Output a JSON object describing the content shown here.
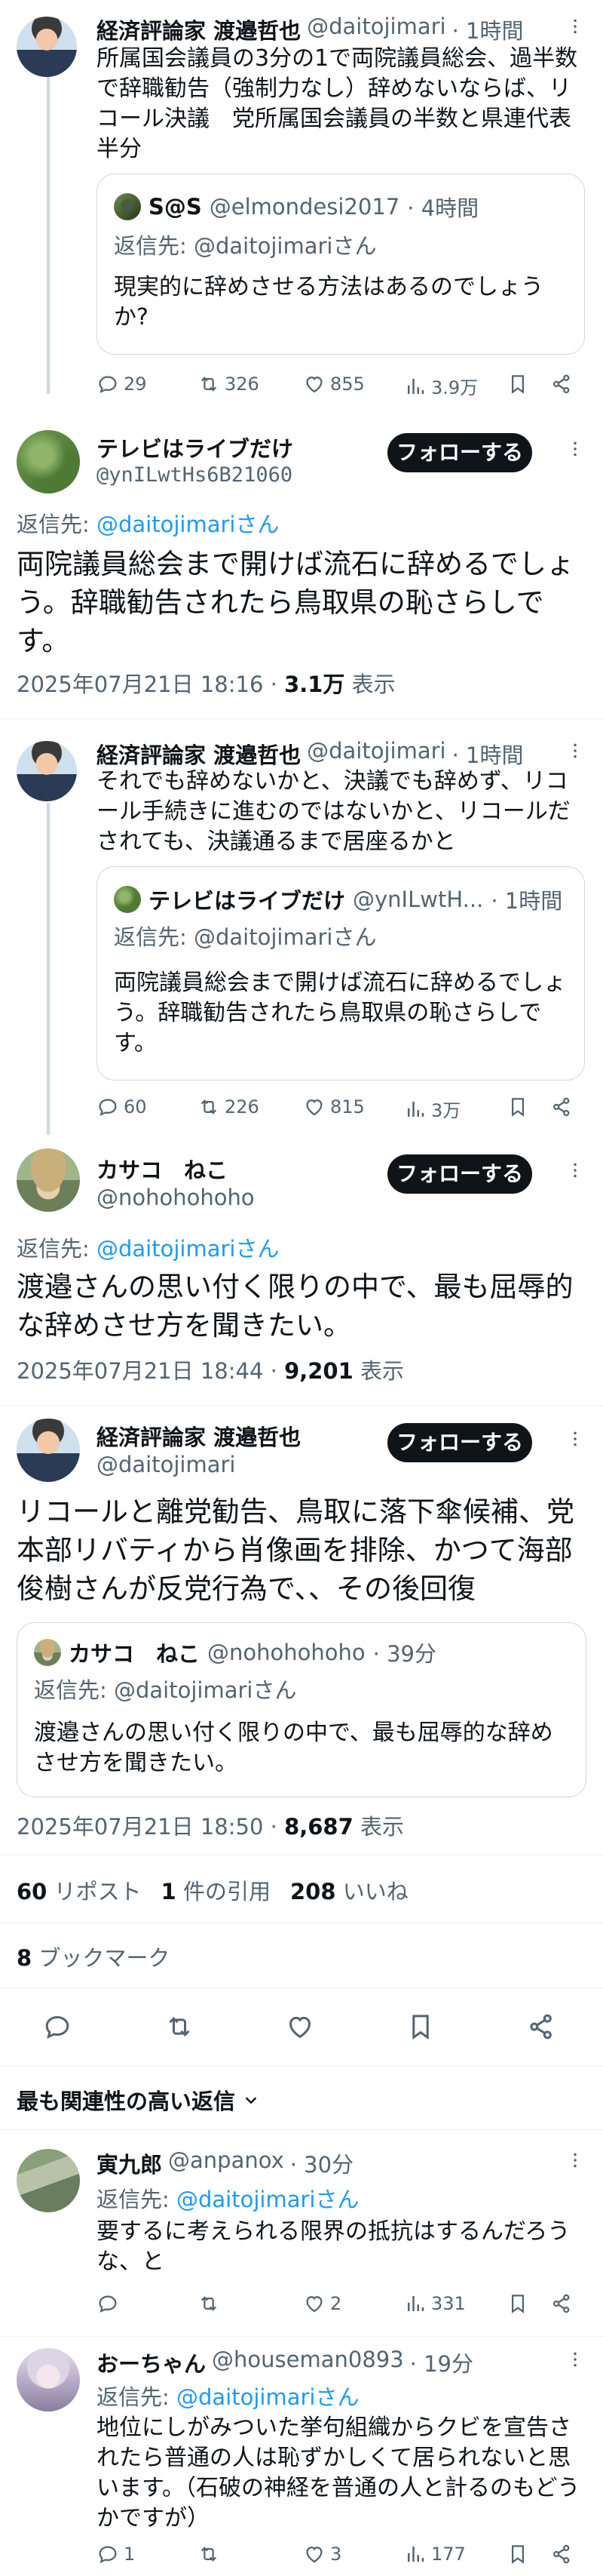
{
  "tweet1": {
    "name": "経済評論家 渡邉哲也",
    "handle": "@daitojimari",
    "time": "· 1時間",
    "text": "所属国会議員の3分の1で両院議員総会、過半数で辞職勧告（強制力なし）辞めないならば、リコール決議　党所属国会議員の半数と県連代表半分",
    "quote": {
      "name": "S@S",
      "handle": "@elmondesi2017",
      "time": "· 4時間",
      "reply_to": "返信先: @daitojimariさん",
      "text": "現実的に辞めさせる方法はあるのでしょうか?"
    },
    "actions": {
      "replies": "29",
      "reposts": "326",
      "likes": "855",
      "views": "3.9万"
    }
  },
  "tweet2": {
    "name": "テレビはライブだけ",
    "handle": "@ynILwtHs6B21060",
    "follow_label": "フォローする",
    "reply_prefix": "返信先: ",
    "reply_to": "@daitojimariさん",
    "text": "両院議員総会まで開けば流石に辞めるでしょう。辞職勧告されたら鳥取県の恥さらしです。",
    "timestamp": "2025年07月21日 18:16 · ",
    "views_count": "3.1万",
    "views_label": " 表示"
  },
  "tweet3": {
    "name": "経済評論家 渡邉哲也",
    "handle": "@daitojimari",
    "time": "· 1時間",
    "text": "それでも辞めないかと、決議でも辞めず、リコール手続きに進むのではないかと、リコールだされても、決議通るまで居座るかと",
    "quote": {
      "name": "テレビはライブだけ",
      "handle": "@ynILwtH...",
      "time": "· 1時間",
      "reply_to": "返信先: @daitojimariさん",
      "text": "両院議員総会まで開けば流石に辞めるでしょう。辞職勧告されたら鳥取県の恥さらしです。"
    },
    "actions": {
      "replies": "60",
      "reposts": "226",
      "likes": "815",
      "views": "3万"
    }
  },
  "tweet4": {
    "name": "カサコ　ねこ",
    "handle": "@nohohohoho",
    "follow_label": "フォローする",
    "reply_prefix": "返信先: ",
    "reply_to": "@daitojimariさん",
    "text": "渡邉さんの思い付く限りの中で、最も屈辱的な辞めさせ方を聞きたい。",
    "timestamp": "2025年07月21日 18:44 · ",
    "views_count": "9,201",
    "views_label": " 表示"
  },
  "tweet5": {
    "name": "経済評論家 渡邉哲也",
    "handle": "@daitojimari",
    "follow_label": "フォローする",
    "text": "リコールと離党勧告、鳥取に落下傘候補、党本部リバティから肖像画を排除、かつて海部俊樹さんが反党行為で、、その後回復",
    "quote": {
      "name": "カサコ　ねこ",
      "handle": "@nohohohoho",
      "time": "· 39分",
      "reply_to": "返信先: @daitojimariさん",
      "text": "渡邉さんの思い付く限りの中で、最も屈辱的な辞めさせ方を聞きたい。"
    },
    "timestamp": "2025年07月21日 18:50 · ",
    "views_count": "8,687",
    "views_label": " 表示",
    "stats": {
      "reposts_count": "60",
      "reposts_label": " リポスト",
      "quotes_count": "1",
      "quotes_label": " 件の引用",
      "likes_count": "208",
      "likes_label": " いいね",
      "bookmarks_count": "8",
      "bookmarks_label": " ブックマーク"
    }
  },
  "sort": {
    "label": "最も関連性の高い返信"
  },
  "reply1": {
    "name": "寅九郎",
    "handle": "@anpanox",
    "time": "· 30分",
    "reply_prefix": "返信先: ",
    "reply_to": "@daitojimariさん",
    "text": "要するに考えられる限界の抵抗はするんだろうな、と",
    "actions": {
      "replies": "",
      "reposts": "",
      "likes": "2",
      "views": "331"
    }
  },
  "reply2": {
    "name": "おーちゃん",
    "handle": "@houseman0893",
    "time": "· 19分",
    "reply_prefix": "返信先: ",
    "reply_to": "@daitojimariさん",
    "text": "地位にしがみついた挙句組織からクビを宣告されたら普通の人は恥ずかしくて居られないと思います。（石破の神経を普通の人と計るのもどうかですが）",
    "actions": {
      "replies": "1",
      "reposts": "",
      "likes": "3",
      "views": "177"
    }
  },
  "icons": [
    "reply-icon",
    "repost-icon",
    "like-icon",
    "views-icon",
    "bookmark-icon",
    "share-icon",
    "more-icon",
    "chevron-down-icon"
  ]
}
